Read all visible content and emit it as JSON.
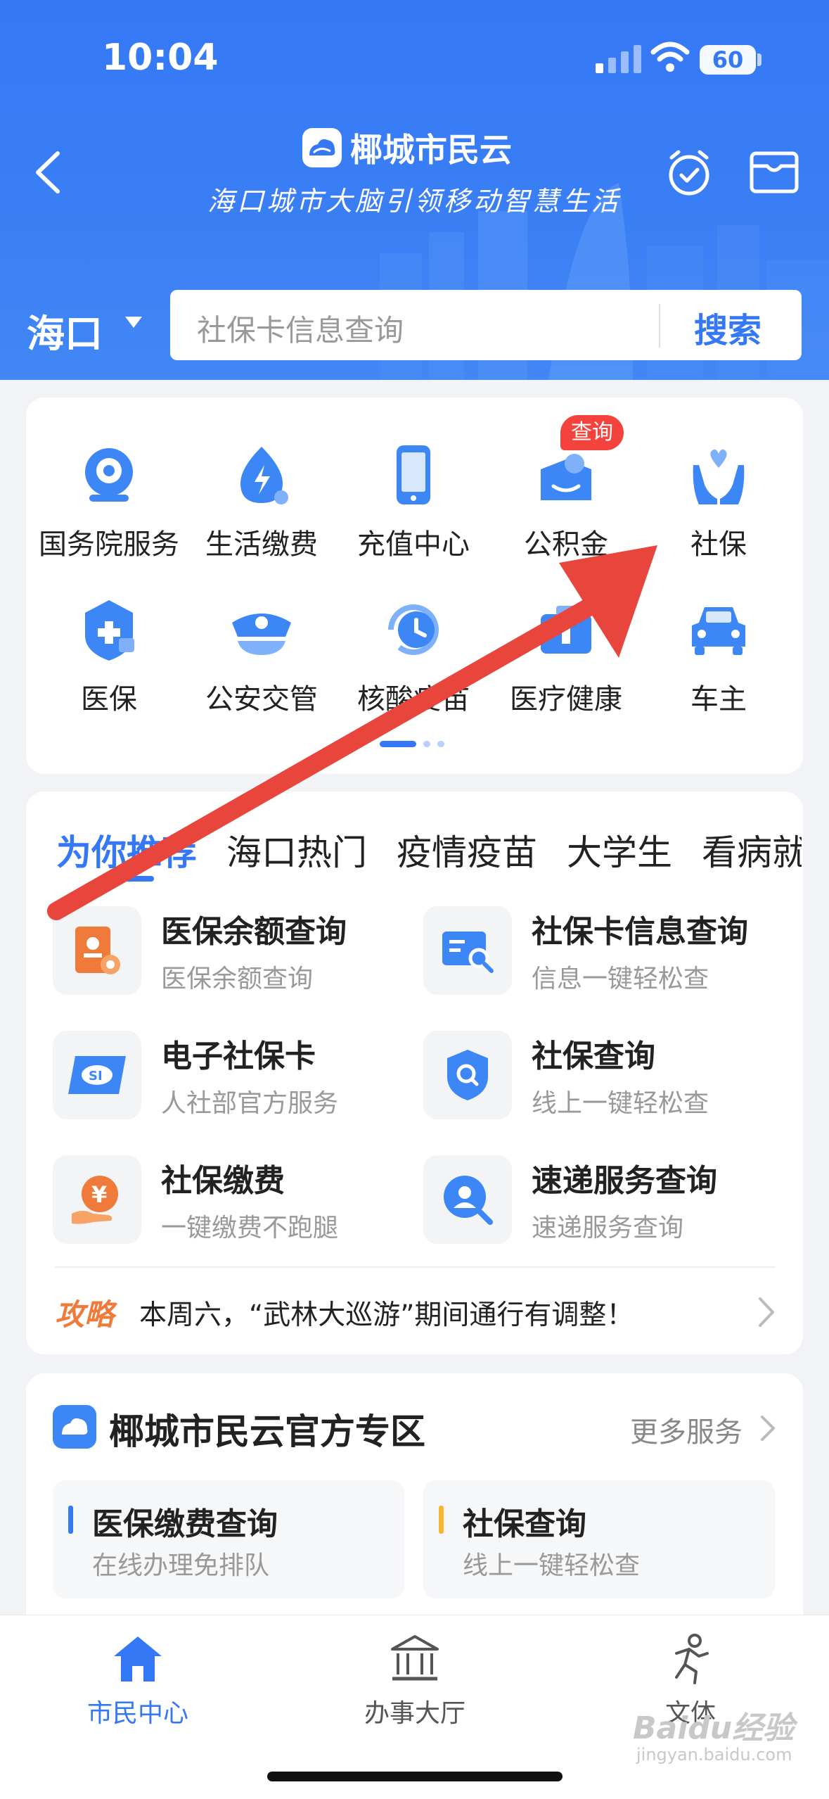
{
  "status_bar": {
    "time": "10:04",
    "battery": "60"
  },
  "header": {
    "app_name": "椰城市民云",
    "slogan": "海口城市大脑引领移动智慧生活",
    "city": "海口",
    "search_placeholder": "社保卡信息查询",
    "search_button": "搜索"
  },
  "services_grid": [
    {
      "label": "国务院服务",
      "icon": "state-council-icon"
    },
    {
      "label": "生活缴费",
      "icon": "lightning-drop-icon"
    },
    {
      "label": "充值中心",
      "icon": "phone-icon"
    },
    {
      "label": "公积金",
      "icon": "housing-fund-icon",
      "badge": "查询"
    },
    {
      "label": "社保",
      "icon": "hands-heart-icon"
    },
    {
      "label": "医保",
      "icon": "medical-shield-icon"
    },
    {
      "label": "公安交管",
      "icon": "police-cap-icon"
    },
    {
      "label": "核酸疫苗",
      "icon": "clock-refresh-icon"
    },
    {
      "label": "医疗健康",
      "icon": "medical-case-icon"
    },
    {
      "label": "车主",
      "icon": "car-icon"
    }
  ],
  "recommend": {
    "tabs": [
      "为你推荐",
      "海口热门",
      "疫情疫苗",
      "大学生",
      "看病就"
    ],
    "items": [
      {
        "title": "医保余额查询",
        "subtitle": "医保余额查询"
      },
      {
        "title": "社保卡信息查询",
        "subtitle": "信息一键轻松查"
      },
      {
        "title": "电子社保卡",
        "subtitle": "人社部官方服务"
      },
      {
        "title": "社保查询",
        "subtitle": "线上一键轻松查"
      },
      {
        "title": "社保缴费",
        "subtitle": "一键缴费不跑腿"
      },
      {
        "title": "速递服务查询",
        "subtitle": "速递服务查询"
      }
    ],
    "tip_tag": "攻略",
    "tip_text": "本周六，“武林大巡游”期间通行有调整！"
  },
  "official": {
    "title": "椰城市民云官方专区",
    "more": "更多服务",
    "items": [
      {
        "title": "医保缴费查询",
        "subtitle": "在线办理免排队",
        "accent": "#3478f6"
      },
      {
        "title": "社保查询",
        "subtitle": "线上一键轻松查",
        "accent": "#f5b731"
      }
    ]
  },
  "bottom_nav": [
    {
      "label": "市民中心",
      "active": true
    },
    {
      "label": "办事大厅",
      "active": false
    },
    {
      "label": "文体",
      "active": false
    }
  ],
  "watermark": {
    "brand": "Baidu经验",
    "url": "jingyan.baidu.com"
  },
  "colors": {
    "primary": "#3478f6",
    "annotation_arrow": "#e8453c",
    "tip": "#f07a3a"
  }
}
